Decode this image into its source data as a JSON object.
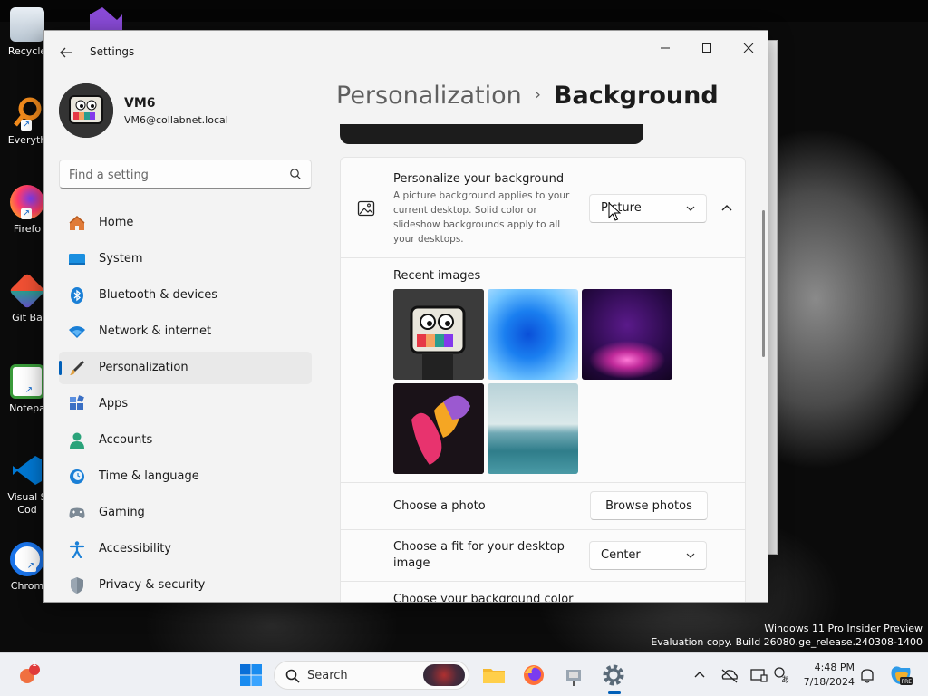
{
  "desktop": {
    "icons": [
      {
        "label": "Recycle",
        "color": "#d0d0d0"
      },
      {
        "label": "Everyth",
        "color": "#f08a1c"
      },
      {
        "label": "Firefo",
        "color": "#ff7139"
      },
      {
        "label": "Git Ba",
        "color": "#f05033"
      },
      {
        "label": "Notepa",
        "color": "#3a9a3a"
      },
      {
        "label": "Visual S Cod",
        "color": "#0078d4"
      },
      {
        "label": "Chrom",
        "color": "#1a73e8"
      }
    ],
    "watermark_line1": "Windows 11 Pro Insider Preview",
    "watermark_line2": "Evaluation copy. Build 26080.ge_release.240308-1400"
  },
  "window": {
    "app_title": "Settings",
    "back_icon": "back-arrow-icon",
    "controls": {
      "minimize": "—",
      "maximize": "☐",
      "close": "✕"
    }
  },
  "profile": {
    "name": "VM6",
    "email": "VM6@collabnet.local"
  },
  "search": {
    "placeholder": "Find a setting",
    "value": ""
  },
  "nav": [
    {
      "label": "Home",
      "icon": "home-icon",
      "active": false
    },
    {
      "label": "System",
      "icon": "system-icon",
      "active": false
    },
    {
      "label": "Bluetooth & devices",
      "icon": "bluetooth-icon",
      "active": false
    },
    {
      "label": "Network & internet",
      "icon": "network-icon",
      "active": false
    },
    {
      "label": "Personalization",
      "icon": "personalization-icon",
      "active": true
    },
    {
      "label": "Apps",
      "icon": "apps-icon",
      "active": false
    },
    {
      "label": "Accounts",
      "icon": "accounts-icon",
      "active": false
    },
    {
      "label": "Time & language",
      "icon": "time-language-icon",
      "active": false
    },
    {
      "label": "Gaming",
      "icon": "gaming-icon",
      "active": false
    },
    {
      "label": "Accessibility",
      "icon": "accessibility-icon",
      "active": false
    },
    {
      "label": "Privacy & security",
      "icon": "privacy-shield-icon",
      "active": false
    }
  ],
  "breadcrumb": {
    "parent": "Personalization",
    "separator": "›",
    "current": "Background"
  },
  "personalize": {
    "title": "Personalize your background",
    "description": "A picture background applies to your current desktop. Solid color or slideshow backgrounds apply to all your desktops.",
    "dropdown_value": "Picture"
  },
  "recent_images": {
    "title": "Recent images",
    "thumbnails": [
      "tv-character",
      "blue-bloom",
      "purple-glow",
      "colorful-ribbon",
      "lake-horizon"
    ]
  },
  "choose_photo": {
    "label": "Choose a photo",
    "button": "Browse photos"
  },
  "choose_fit": {
    "label_line1": "Choose a fit for your desktop",
    "label_line2": "image",
    "dropdown_value": "Center"
  },
  "choose_color": {
    "label": "Choose your background color"
  },
  "taskbar": {
    "search_label": "Search",
    "notification_badge": "1",
    "time": "4:48 PM",
    "date": "7/18/2024",
    "accent": "#005fb8"
  }
}
